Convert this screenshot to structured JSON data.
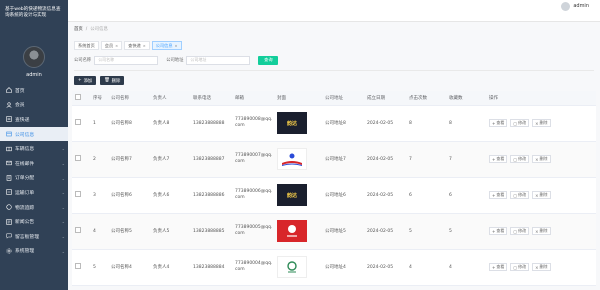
{
  "app": {
    "title": "基于web的快递物流信息查询系统的设计与实现",
    "user": "admin"
  },
  "header": {
    "user": "admin"
  },
  "sidebar": {
    "items": [
      {
        "label": "首页",
        "icon": "home-icon"
      },
      {
        "label": "会员",
        "icon": "user-icon"
      },
      {
        "label": "查快递",
        "icon": "search-icon"
      },
      {
        "label": "公司信息",
        "icon": "company-icon"
      },
      {
        "label": "车辆信息",
        "icon": "truck-icon"
      },
      {
        "label": "在线邮件",
        "icon": "mail-icon"
      },
      {
        "label": "订单分配",
        "icon": "order-icon"
      },
      {
        "label": "运输订单",
        "icon": "transport-icon"
      },
      {
        "label": "物流追踪",
        "icon": "track-icon"
      },
      {
        "label": "新闻公告",
        "icon": "news-icon"
      },
      {
        "label": "留言板管理",
        "icon": "message-icon"
      },
      {
        "label": "系统管理",
        "icon": "gear-icon"
      }
    ]
  },
  "breadcrumb": {
    "home": "首页",
    "sep": "/",
    "current": "公司信息"
  },
  "tabs": [
    {
      "label": "系统首页",
      "closable": false
    },
    {
      "label": "会员",
      "closable": true
    },
    {
      "label": "查快递",
      "closable": true
    },
    {
      "label": "公司信息",
      "closable": true
    }
  ],
  "search": {
    "field1_label": "公司名称",
    "field1_placeholder": "公司名称",
    "field2_label": "公司地址",
    "field2_placeholder": "公司地址",
    "button": "查询"
  },
  "actions": {
    "add": "添加",
    "delete": "删除"
  },
  "table": {
    "headers": [
      "",
      "序号",
      "公司名称",
      "负责人",
      "联系电话",
      "邮箱",
      "封面",
      "公司地址",
      "成立日期",
      "点击次数",
      "收藏数",
      "操作"
    ],
    "rows": [
      {
        "index": "1",
        "name": "公司名称8",
        "leader": "负责人8",
        "phone": "13823888888",
        "email": "773890008@qq.com",
        "cover_text": "韵达",
        "cover_color": "#1a1f2e",
        "address": "公司地址8",
        "date": "2024-02-05",
        "clicks": "8",
        "favorites": "8"
      },
      {
        "index": "2",
        "name": "公司名称7",
        "leader": "负责人7",
        "phone": "13823888887",
        "email": "773890007@qq.com",
        "cover_text": "",
        "cover_color": "#ffffff",
        "address": "公司地址7",
        "date": "2024-02-05",
        "clicks": "7",
        "favorites": "7"
      },
      {
        "index": "3",
        "name": "公司名称6",
        "leader": "负责人6",
        "phone": "13823888886",
        "email": "773890006@qq.com",
        "cover_text": "韵达",
        "cover_color": "#1a1f2e",
        "address": "公司地址6",
        "date": "2024-02-05",
        "clicks": "6",
        "favorites": "6"
      },
      {
        "index": "4",
        "name": "公司名称5",
        "leader": "负责人5",
        "phone": "13823888885",
        "email": "773890005@qq.com",
        "cover_text": "",
        "cover_color": "#d8262a",
        "address": "公司地址5",
        "date": "2024-02-05",
        "clicks": "5",
        "favorites": "5"
      },
      {
        "index": "5",
        "name": "公司名称4",
        "leader": "负责人4",
        "phone": "13823888884",
        "email": "773890004@qq.com",
        "cover_text": "",
        "cover_color": "#ffffff",
        "address": "公司地址4",
        "date": "2024-02-05",
        "clicks": "4",
        "favorites": "4"
      }
    ],
    "ops": {
      "view": "查看",
      "edit": "修改",
      "delete": "删除"
    }
  }
}
